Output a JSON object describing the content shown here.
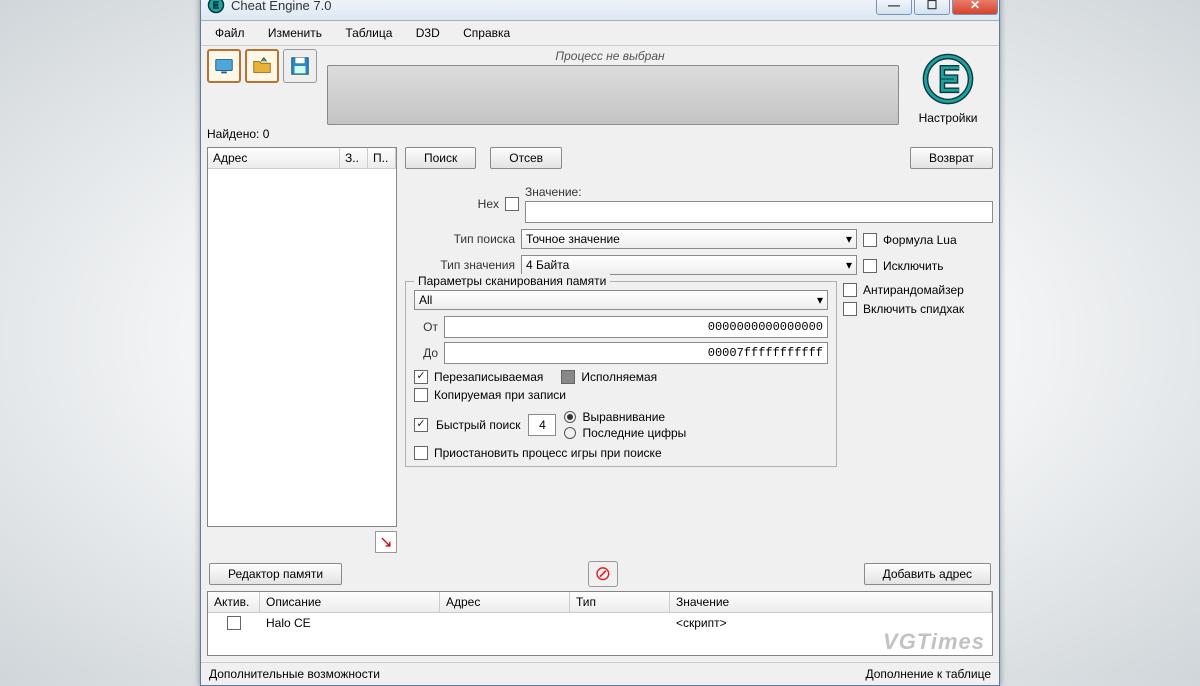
{
  "title": "Cheat Engine 7.0",
  "menu": {
    "file": "Файл",
    "edit": "Изменить",
    "table": "Таблица",
    "d3d": "D3D",
    "help": "Справка"
  },
  "process_status": "Процесс не выбран",
  "found_label": "Найдено:",
  "found_count": "0",
  "results_columns": {
    "address": "Адрес",
    "val": "З..",
    "prev": "П.."
  },
  "buttons": {
    "search": "Поиск",
    "filter": "Отсев",
    "undo": "Возврат",
    "mem_editor": "Редактор памяти",
    "add_addr": "Добавить адрес"
  },
  "settings_label": "Настройки",
  "value_label": "Значение:",
  "hex_label": "Hex",
  "scan_type_label": "Тип поиска",
  "scan_type_value": "Точное значение",
  "value_type_label": "Тип значения",
  "value_type_value": "4 Байта",
  "rhs_checks": {
    "lua": "Формула Lua",
    "exclude": "Исключить",
    "antirand": "Антирандомайзер",
    "speedhack": "Включить спидхак"
  },
  "scan_params": {
    "legend": "Параметры сканирования памяти",
    "all": "All",
    "from_label": "От",
    "from_value": "0000000000000000",
    "to_label": "До",
    "to_value": "00007fffffffffff",
    "writable": "Перезаписываемая",
    "executable": "Исполняемая",
    "cow": "Копируемая при записи",
    "fast": "Быстрый поиск",
    "fast_val": "4",
    "align": "Выравнивание",
    "last_digits": "Последние цифры",
    "pause": "Приостановить процесс игры при поиске"
  },
  "addr_table": {
    "cols": {
      "active": "Актив.",
      "desc": "Описание",
      "addr": "Адрес",
      "type": "Тип",
      "value": "Значение"
    },
    "rows": [
      {
        "desc": "Halo CE",
        "addr": "",
        "type": "",
        "value": "<скрипт>"
      }
    ]
  },
  "status": {
    "left": "Дополнительные возможности",
    "right": "Дополнение к таблице"
  },
  "watermark": "VGTimes"
}
